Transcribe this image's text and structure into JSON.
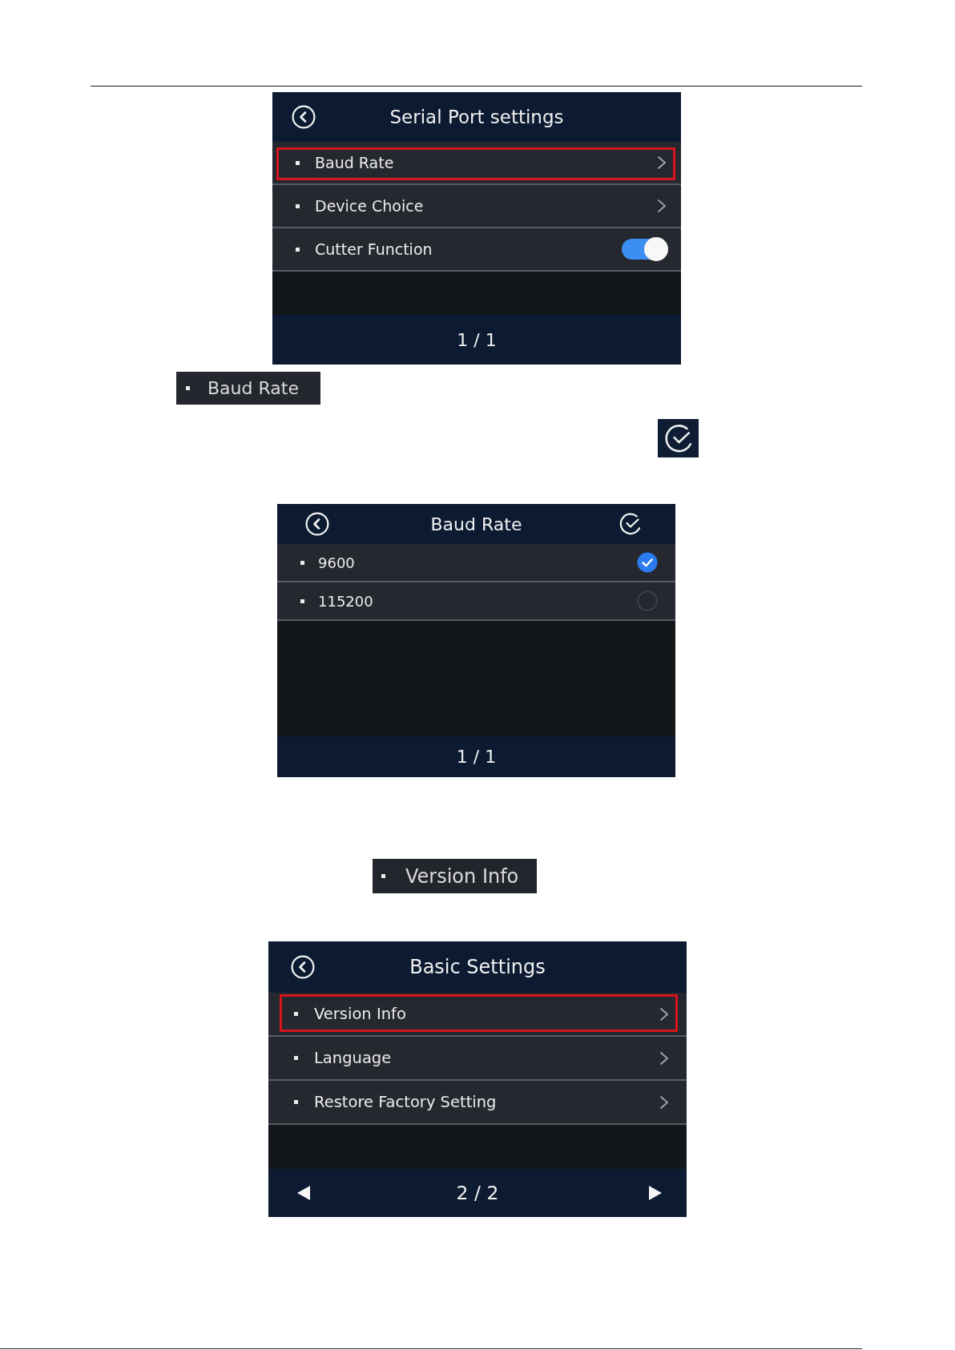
{
  "serial_port_screen": {
    "title": "Serial Port settings",
    "confirm": false,
    "items": [
      {
        "kind": "link",
        "label": "Baud Rate",
        "highlighted": true
      },
      {
        "kind": "link",
        "label": "Device Choice",
        "highlighted": false
      },
      {
        "kind": "toggle",
        "label": "Cutter Function",
        "highlighted": false,
        "on": true
      }
    ],
    "page_indicator": "1 / 1",
    "page_arrows": false
  },
  "baud_rate_snippet": {
    "label": "Baud Rate"
  },
  "baud_rate_screen": {
    "title": "Baud Rate",
    "confirm": true,
    "items": [
      {
        "kind": "radio",
        "label": "9600",
        "highlighted": false,
        "selected": true
      },
      {
        "kind": "radio",
        "label": "115200",
        "highlighted": false,
        "selected": false
      }
    ],
    "page_indicator": "1 / 1",
    "page_arrows": false
  },
  "version_info_snippet": {
    "label": "Version Info"
  },
  "basic_settings_screen": {
    "title": "Basic Settings",
    "confirm": false,
    "items": [
      {
        "kind": "link",
        "label": "Version Info",
        "highlighted": true
      },
      {
        "kind": "link",
        "label": "Language",
        "highlighted": false
      },
      {
        "kind": "link",
        "label": "Restore Factory Setting",
        "highlighted": false
      }
    ],
    "page_indicator": "2 / 2",
    "page_arrows": true
  }
}
